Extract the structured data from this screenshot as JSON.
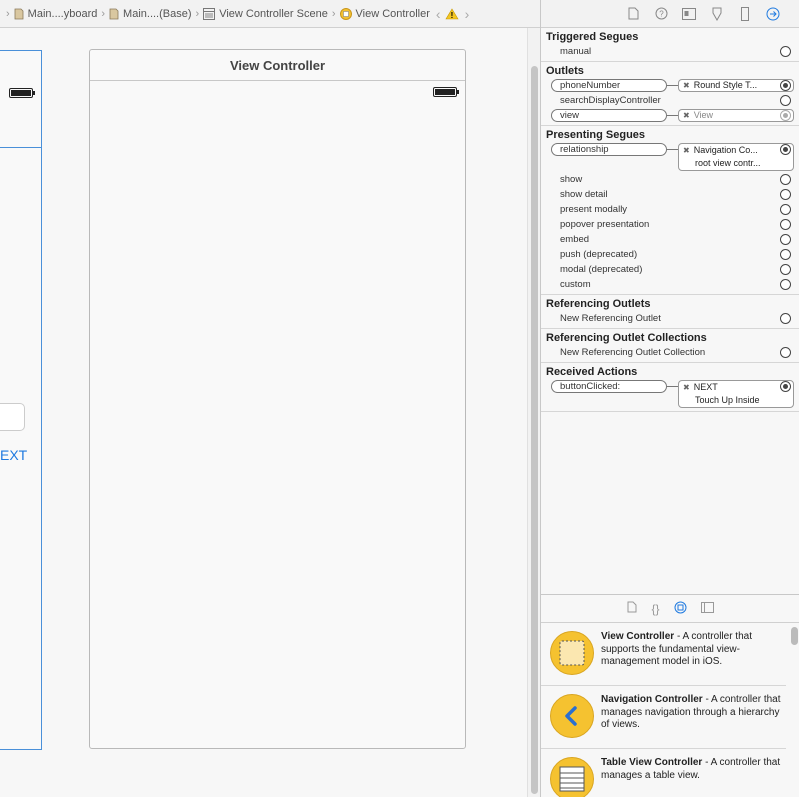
{
  "jumpbar": {
    "items": [
      "Main....yboard",
      "Main....(Base)",
      "View Controller Scene",
      "View Controller"
    ]
  },
  "canvas": {
    "left_button": "EXT",
    "scene_title": "View Controller"
  },
  "inspector": {
    "triggered_segues": {
      "title": "Triggered Segues",
      "manual": "manual"
    },
    "outlets": {
      "title": "Outlets",
      "phone_number": "phoneNumber",
      "phone_target": "Round Style T...",
      "search_display": "searchDisplayController",
      "view": "view",
      "view_target": "View"
    },
    "presenting_segues": {
      "title": "Presenting Segues",
      "relationship": "relationship",
      "rel_target": "Navigation Co...",
      "rel_sub": "root view contr...",
      "items": [
        "show",
        "show detail",
        "present modally",
        "popover presentation",
        "embed",
        "push (deprecated)",
        "modal (deprecated)",
        "custom"
      ]
    },
    "referencing_outlets": {
      "title": "Referencing Outlets",
      "new": "New Referencing Outlet"
    },
    "referencing_collections": {
      "title": "Referencing Outlet Collections",
      "new": "New Referencing Outlet Collection"
    },
    "received_actions": {
      "title": "Received Actions",
      "button_clicked": "buttonClicked:",
      "target": "NEXT",
      "target_sub": "Touch Up Inside"
    }
  },
  "library": {
    "items": [
      {
        "name": "View Controller",
        "desc": " - A controller that supports the fundamental view-management model in iOS."
      },
      {
        "name": "Navigation Controller",
        "desc": " - A controller that manages navigation through a hierarchy of views."
      },
      {
        "name": "Table View Controller",
        "desc": " - A controller that manages a table view."
      }
    ]
  },
  "colors": {
    "accent": "#1f7ae0",
    "library_icon": "#f5c230",
    "selection_border": "#4a90d9"
  }
}
